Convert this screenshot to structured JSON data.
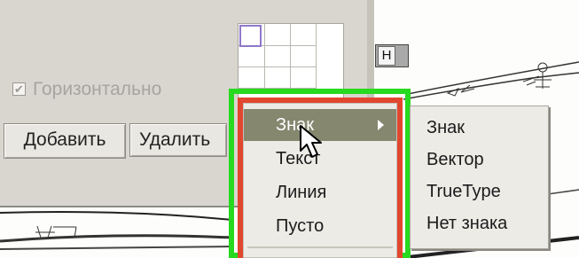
{
  "dialog": {
    "checkbox_label": "Горизонтально",
    "checkbox_checked": true,
    "buttons": {
      "add": "Добавить",
      "delete": "Удалить"
    }
  },
  "map_tag": {
    "label": "Н"
  },
  "context_menu": {
    "items": [
      "Знак",
      "Текст",
      "Линия",
      "Пусто"
    ],
    "active_index": 0
  },
  "submenu": {
    "items": [
      "Знак",
      "Вектор",
      "TrueType",
      "Нет знака"
    ]
  },
  "colors": {
    "highlight_outer": "#27d91f",
    "highlight_inner": "#e1472f",
    "menu_active": "#85876f"
  },
  "icons": [
    "submenu-arrow-icon",
    "mouse-cursor-icon",
    "checkmark-icon"
  ]
}
